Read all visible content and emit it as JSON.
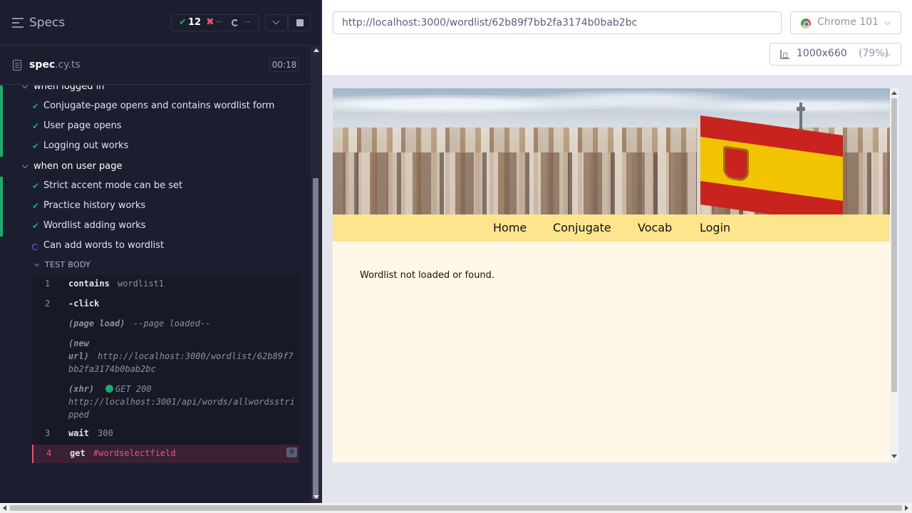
{
  "specs_header": {
    "title": "Specs",
    "passed_count": "12",
    "failed_count": "--",
    "pending_count": "--"
  },
  "spec": {
    "file_base": "spec",
    "file_ext": ".cy.ts",
    "duration": "00:18"
  },
  "suites": [
    {
      "label": "when logged in",
      "tests": [
        {
          "label": "Conjugate-page opens and contains wordlist form",
          "state": "passed"
        },
        {
          "label": "User page opens",
          "state": "passed"
        },
        {
          "label": "Logging out works",
          "state": "passed"
        }
      ]
    },
    {
      "label": "when on user page",
      "tests": [
        {
          "label": "Strict accent mode can be set",
          "state": "passed"
        },
        {
          "label": "Practice history works",
          "state": "passed"
        },
        {
          "label": "Wordlist adding works",
          "state": "passed"
        },
        {
          "label": "Can add words to wordlist",
          "state": "running"
        }
      ]
    }
  ],
  "test_body_label": "TEST BODY",
  "commands": [
    {
      "num": "1",
      "name": "contains",
      "message": "wordlist1"
    },
    {
      "num": "2",
      "name": "-click",
      "message": ""
    },
    {
      "event": "(page load)",
      "message": "--page loaded--"
    },
    {
      "event_line1": "(new",
      "event_line2": "url)",
      "message_line1": "http://localhost:3000/wordlist/62b89f7",
      "message_line2": "bb2fa3174b0bab2bc"
    },
    {
      "event": "(xhr)",
      "status": "GET 200",
      "message_line1": "http://localhost:3001/api/words/allwordsstri",
      "message_line2": "pped"
    },
    {
      "num": "3",
      "name": "wait",
      "message": "300"
    },
    {
      "num": "4",
      "name": "get",
      "message": "#wordselectfield",
      "badge": "0",
      "state": "failed"
    }
  ],
  "aut_header": {
    "url": "http://localhost:3000/wordlist/62b89f7bb2fa3174b0bab2bc",
    "browser": "Chrome 101",
    "viewport_size": "1000x660",
    "viewport_scale": "(79%)"
  },
  "app": {
    "nav": [
      "Home",
      "Conjugate",
      "Vocab",
      "Login"
    ],
    "message": "Wordlist not loaded or found."
  },
  "colors": {
    "passed": "#1fa971",
    "failed": "#e45770",
    "running": "#6470f3",
    "navbar": "#fde58d",
    "page_bg": "#fff8e6"
  },
  "icons": [
    "menu-icon",
    "check-icon",
    "x-icon",
    "spinner-icon",
    "chevron-down-icon",
    "stop-icon",
    "file-icon",
    "chrome-icon",
    "ruler-icon"
  ]
}
